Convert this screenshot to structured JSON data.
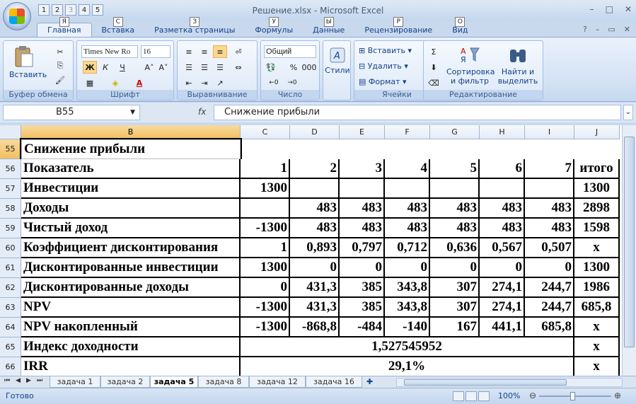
{
  "window": {
    "title": "Решение.xlsx - Microsoft Excel",
    "controls": [
      "–",
      "□",
      "✕"
    ]
  },
  "qat": {
    "keytips": [
      "1",
      "2",
      "3",
      "4",
      "5"
    ]
  },
  "tabs": [
    {
      "label": "Главная",
      "keytip": "Я"
    },
    {
      "label": "Вставка",
      "keytip": "С"
    },
    {
      "label": "Разметка страницы",
      "keytip": "З"
    },
    {
      "label": "Формулы",
      "keytip": "У"
    },
    {
      "label": "Данные",
      "keytip": "Ы"
    },
    {
      "label": "Рецензирование",
      "keytip": "Р"
    },
    {
      "label": "Вид",
      "keytip": "О"
    }
  ],
  "ribbon": {
    "clipboard": {
      "label": "Буфер обмена",
      "paste": "Вставить"
    },
    "font": {
      "label": "Шрифт",
      "name": "Times New Ro",
      "size": "16",
      "bold": "Ж",
      "italic": "К",
      "underline": "Ч"
    },
    "alignment": {
      "label": "Выравнивание"
    },
    "number": {
      "label": "Число",
      "format": "Общий",
      "percent": "%",
      "thousands": "000"
    },
    "styles": {
      "label": "Стили"
    },
    "cells": {
      "label": "Ячейки",
      "insert": "Вставить",
      "delete": "Удалить",
      "format": "Формат"
    },
    "editing": {
      "label": "Редактирование",
      "sort_line1": "Сортировка",
      "sort_line2": "и фильтр",
      "find_line1": "Найти и",
      "find_line2": "выделить"
    }
  },
  "formula_bar": {
    "name_box": "B55",
    "fx": "fx",
    "value": "Снижение прибыли"
  },
  "columns": [
    "B",
    "C",
    "D",
    "E",
    "F",
    "G",
    "H",
    "I",
    "J"
  ],
  "rows": [
    {
      "num": "55",
      "cells": [
        "Снижение прибыли"
      ]
    },
    {
      "num": "56",
      "cells": [
        "Показатель",
        "1",
        "2",
        "3",
        "4",
        "5",
        "6",
        "7",
        "итого"
      ]
    },
    {
      "num": "57",
      "cells": [
        "Инвестиции",
        "1300",
        "",
        "",
        "",
        "",
        "",
        "",
        "1300"
      ]
    },
    {
      "num": "58",
      "cells": [
        "Доходы",
        "",
        "483",
        "483",
        "483",
        "483",
        "483",
        "483",
        "2898"
      ]
    },
    {
      "num": "59",
      "cells": [
        "Чистый доход",
        "-1300",
        "483",
        "483",
        "483",
        "483",
        "483",
        "483",
        "1598"
      ]
    },
    {
      "num": "60",
      "cells": [
        "Коэффициент дисконтирования",
        "1",
        "0,893",
        "0,797",
        "0,712",
        "0,636",
        "0,567",
        "0,507",
        "х"
      ]
    },
    {
      "num": "61",
      "cells": [
        "Дисконтированные инвестиции",
        "1300",
        "0",
        "0",
        "0",
        "0",
        "0",
        "0",
        "1300"
      ]
    },
    {
      "num": "62",
      "cells": [
        "Дисконтированные доходы",
        "0",
        "431,3",
        "385",
        "343,8",
        "307",
        "274,1",
        "244,7",
        "1986"
      ]
    },
    {
      "num": "63",
      "cells": [
        "NPV",
        "-1300",
        "431,3",
        "385",
        "343,8",
        "307",
        "274,1",
        "244,7",
        "685,8"
      ]
    },
    {
      "num": "64",
      "cells": [
        "NPV накопленный",
        "-1300",
        "-868,8",
        "-484",
        "-140",
        "167",
        "441,1",
        "685,8",
        "х"
      ]
    },
    {
      "num": "65",
      "cells": [
        "Индекс доходности",
        "1,527545952",
        "х"
      ]
    },
    {
      "num": "66",
      "cells": [
        "IRR",
        "29,1%",
        "х"
      ]
    }
  ],
  "sheets": [
    "задача 1",
    "задача 2",
    "задача 5",
    "задача 8",
    "задача 12",
    "задача 16"
  ],
  "active_sheet": "задача 5",
  "status": {
    "ready": "Готово",
    "zoom": "100%"
  }
}
